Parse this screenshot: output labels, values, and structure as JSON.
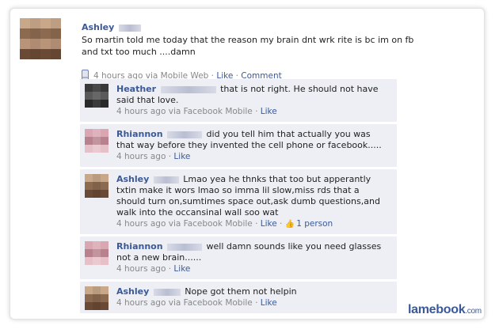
{
  "post": {
    "author": "Ashley",
    "text": "So martin told me today that the reason my brain dnt wrk rite is bc im on fb and txt too much ....damn",
    "time": "4 hours ago via Mobile Web",
    "like_label": "Like",
    "comment_label": "Comment"
  },
  "comments": [
    {
      "author": "Heather",
      "text": "that is not right. He should not have said that love.",
      "time": "4 hours ago via Facebook Mobile",
      "like_label": "Like"
    },
    {
      "author": "Rhiannon",
      "text": "did you tell him that actually you was that way before they invented the cell phone or facebook.....",
      "time": "4 hours ago",
      "like_label": "Like"
    },
    {
      "author": "Ashley",
      "text": "Lmao yea he thnks that too but apperantly txtin make it wors lmao so imma lil slow,miss rds that a should turn on,sumtimes space out,ask dumb questions,and walk into the occansinal wall soo wat",
      "time": "4 hours ago via Facebook Mobile",
      "like_label": "Like",
      "likes_count": "1 person"
    },
    {
      "author": "Rhiannon",
      "text": "well damn sounds like you need glasses not a new brain......",
      "time": "4 hours ago",
      "like_label": "Like"
    },
    {
      "author": "Ashley",
      "text": "Nope got them not helpin",
      "time": "4 hours ago via Facebook Mobile",
      "like_label": "Like"
    }
  ],
  "watermark": {
    "brand": "lamebook",
    "tld": ".com"
  },
  "colors": {
    "link": "#3b5998",
    "comment_bg": "#edeff4"
  },
  "icons": {
    "mobile": "phone-icon",
    "like": "thumbs-up-icon"
  }
}
